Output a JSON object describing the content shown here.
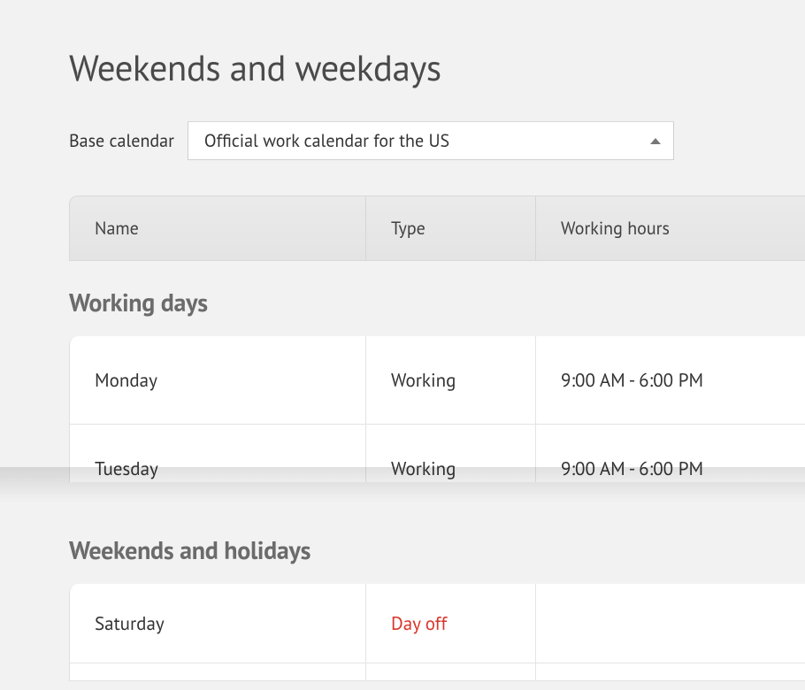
{
  "page": {
    "title": "Weekends and weekdays"
  },
  "baseCalendar": {
    "label": "Base calendar",
    "value": "Official work calendar for the US"
  },
  "table": {
    "headers": {
      "name": "Name",
      "type": "Type",
      "hours": "Working hours"
    }
  },
  "sections": {
    "working": {
      "title": "Working days",
      "rows": [
        {
          "name": "Monday",
          "type": "Working",
          "hours": "9:00 AM - 6:00 PM"
        },
        {
          "name": "Tuesday",
          "type": "Working",
          "hours": "9:00 AM - 6:00 PM"
        }
      ]
    },
    "weekends": {
      "title": "Weekends and holidays",
      "rows": [
        {
          "name": "Saturday",
          "type": "Day off",
          "hours": ""
        }
      ]
    }
  }
}
